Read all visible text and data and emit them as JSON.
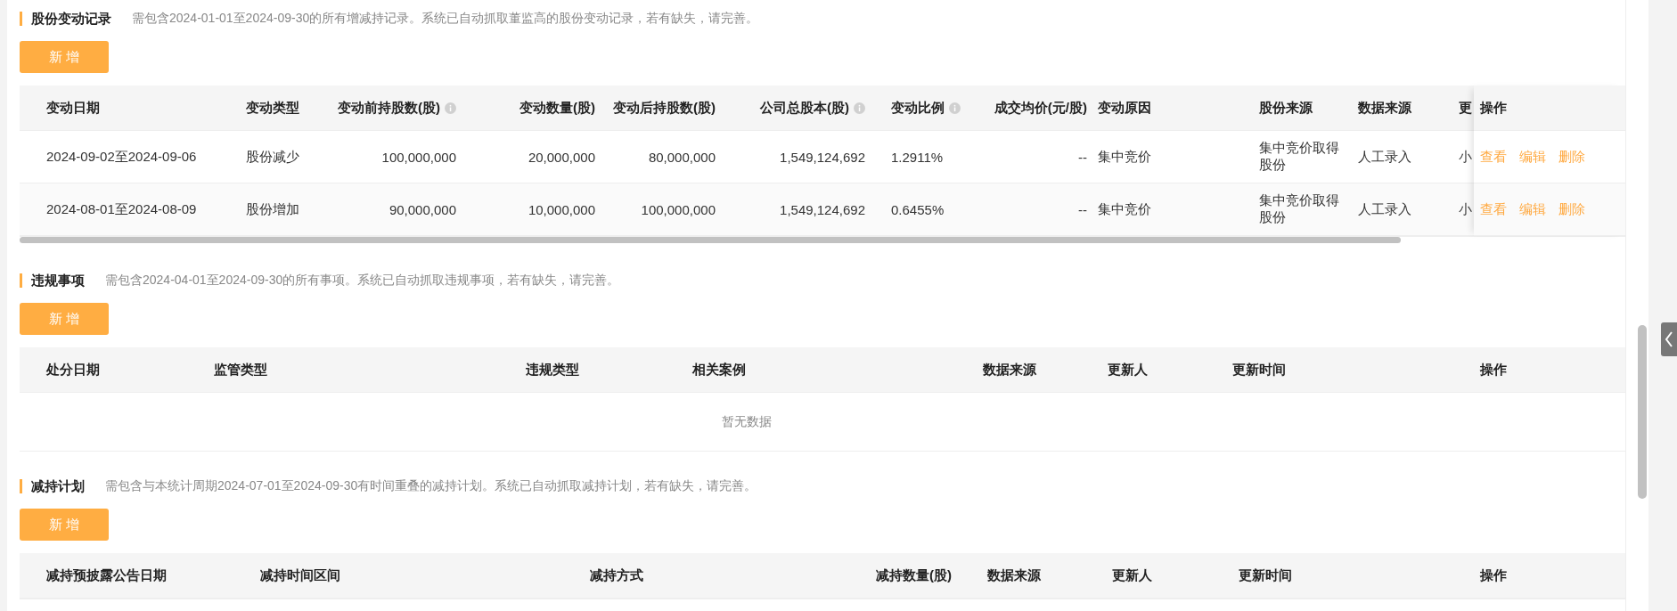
{
  "sections": [
    {
      "title": "股份变动记录",
      "note": "需包含2024-01-01至2024-09-30的所有增减持记录。系统已自动抓取董监高的股份变动记录，若有缺失，请完善。",
      "add_button": "新 增",
      "horizontal_scroll": true,
      "columns": [
        {
          "label": "变动日期",
          "info": false
        },
        {
          "label": "变动类型",
          "info": false
        },
        {
          "label": "变动前持股数(股)",
          "info": true
        },
        {
          "label": "变动数量(股)",
          "info": false
        },
        {
          "label": "变动后持股数(股)",
          "info": false
        },
        {
          "label": "公司总股本(股)",
          "info": true
        },
        {
          "label": "变动比例",
          "info": true
        },
        {
          "label": "成交均价(元/股)",
          "info": false
        },
        {
          "label": "变动原因",
          "info": false
        },
        {
          "label": "股份来源",
          "info": false
        },
        {
          "label": "数据来源",
          "info": false
        },
        {
          "label": "更"
        }
      ],
      "actions_header": "操作",
      "rows": [
        {
          "cells": [
            "2024-09-02至2024-09-06",
            "股份减少",
            "100,000,000",
            "20,000,000",
            "80,000,000",
            "1,549,124,692",
            "1.2911%",
            "--",
            "集中竞价",
            "集中竞价取得股份",
            "人工录入",
            "小"
          ],
          "actions": [
            "查看",
            "编辑",
            "删除"
          ]
        },
        {
          "cells": [
            "2024-08-01至2024-08-09",
            "股份增加",
            "90,000,000",
            "10,000,000",
            "100,000,000",
            "1,549,124,692",
            "0.6455%",
            "--",
            "集中竞价",
            "集中竞价取得股份",
            "人工录入",
            "小"
          ],
          "actions": [
            "查看",
            "编辑",
            "删除"
          ]
        }
      ]
    },
    {
      "title": "违规事项",
      "note": "需包含2024-04-01至2024-09-30的所有事项。系统已自动抓取违规事项，若有缺失，请完善。",
      "add_button": "新 增",
      "horizontal_scroll": false,
      "columns": [
        {
          "label": "处分日期",
          "info": false
        },
        {
          "label": "监管类型",
          "info": false
        },
        {
          "label": "违规类型",
          "info": false
        },
        {
          "label": "相关案例",
          "info": false
        },
        {
          "label": "数据来源",
          "info": false
        },
        {
          "label": "更新人",
          "info": false
        },
        {
          "label": "更新时间",
          "info": false
        }
      ],
      "actions_header": "操作",
      "empty_text": "暂无数据"
    },
    {
      "title": "减持计划",
      "note": "需包含与本统计周期2024-07-01至2024-09-30有时间重叠的减持计划。系统已自动抓取减持计划，若有缺失，请完善。",
      "add_button": "新 增",
      "horizontal_scroll": false,
      "columns": [
        {
          "label": "减持预披露公告日期",
          "info": false
        },
        {
          "label": "减持时间区间",
          "info": false
        },
        {
          "label": "减持方式",
          "info": false
        },
        {
          "label": "减持数量(股)",
          "info": false
        },
        {
          "label": "数据来源",
          "info": false
        },
        {
          "label": "更新人",
          "info": false
        },
        {
          "label": "更新时间",
          "info": false
        }
      ],
      "actions_header": "操作"
    }
  ]
}
